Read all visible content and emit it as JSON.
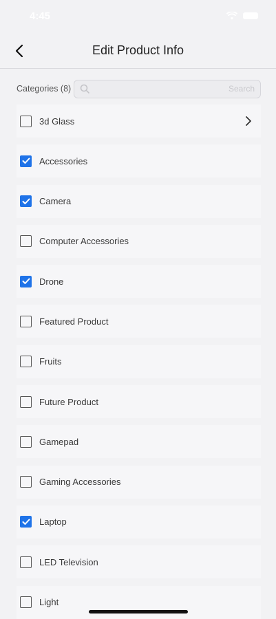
{
  "status_bar": {
    "time": "4:45"
  },
  "header": {
    "title": "Edit Product Info"
  },
  "categories": {
    "label": "Categories (8)",
    "search_placeholder": "Search"
  },
  "items": [
    {
      "label": "3d Glass",
      "checked": false,
      "has_chevron": true
    },
    {
      "label": "Accessories",
      "checked": true,
      "has_chevron": false
    },
    {
      "label": "Camera",
      "checked": true,
      "has_chevron": false
    },
    {
      "label": "Computer Accessories",
      "checked": false,
      "has_chevron": false
    },
    {
      "label": "Drone",
      "checked": true,
      "has_chevron": false
    },
    {
      "label": "Featured Product",
      "checked": false,
      "has_chevron": false
    },
    {
      "label": "Fruits",
      "checked": false,
      "has_chevron": false
    },
    {
      "label": "Future Product",
      "checked": false,
      "has_chevron": false
    },
    {
      "label": "Gamepad",
      "checked": false,
      "has_chevron": false
    },
    {
      "label": "Gaming Accessories",
      "checked": false,
      "has_chevron": false
    },
    {
      "label": "Laptop",
      "checked": true,
      "has_chevron": false
    },
    {
      "label": "LED Television",
      "checked": false,
      "has_chevron": false
    },
    {
      "label": "Light",
      "checked": false,
      "has_chevron": false
    }
  ],
  "colors": {
    "accent": "#1f73e8",
    "background": "#f2f2f4"
  }
}
